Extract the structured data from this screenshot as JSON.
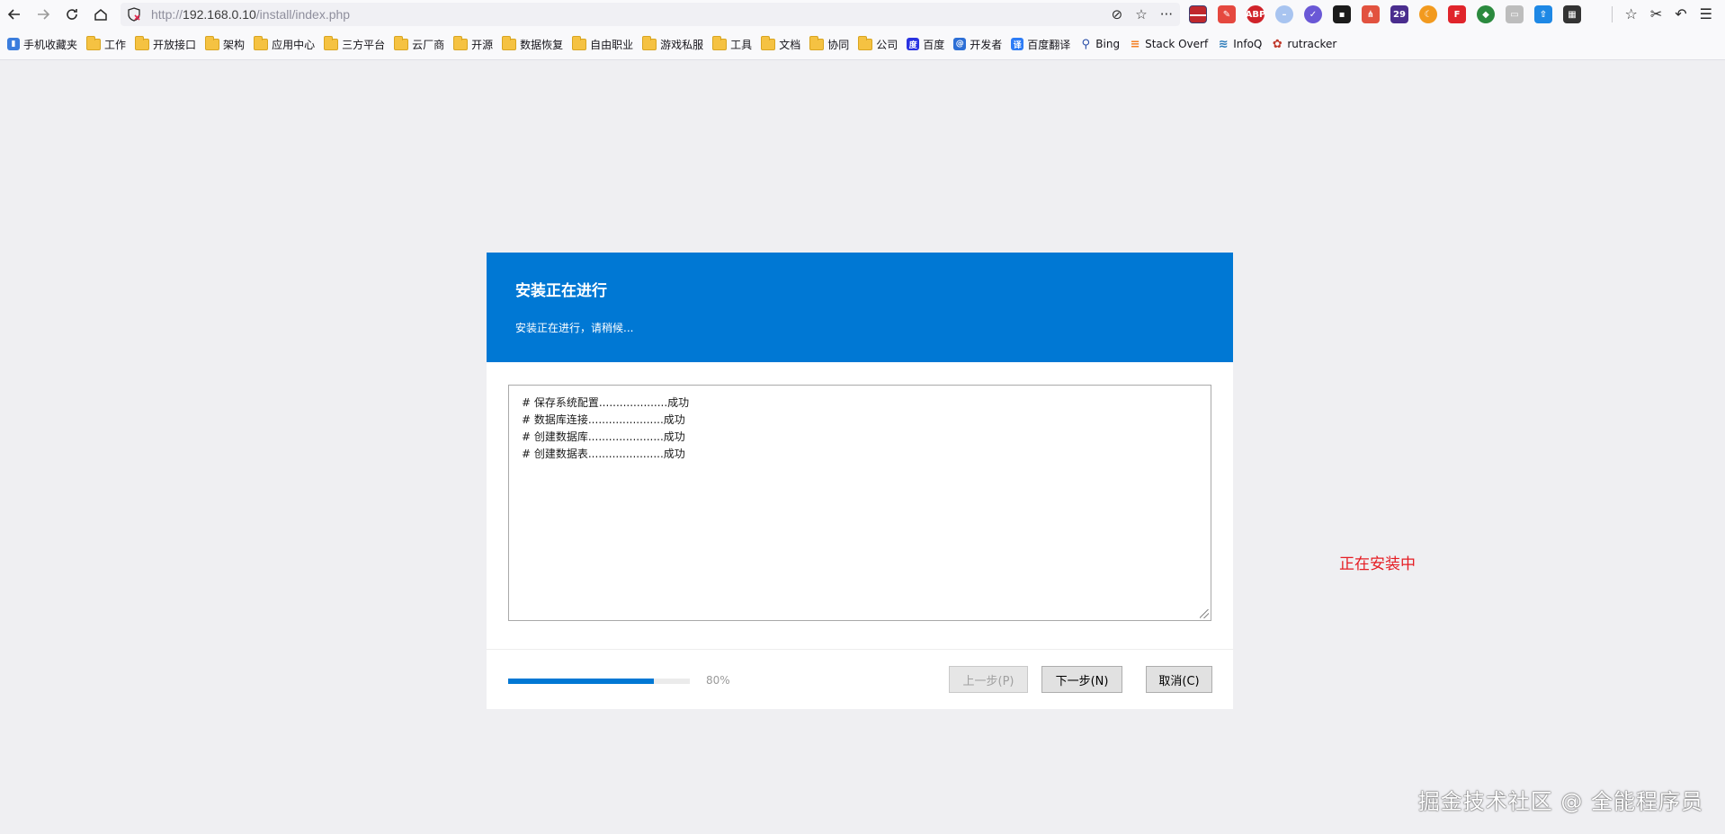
{
  "browser": {
    "url_prefix": "http://",
    "url_host": "192.168.0.10",
    "url_path": "/install/index.php"
  },
  "bookmarks": [
    {
      "label": "手机收藏夹",
      "icon": "mobile-bookmarks-icon"
    },
    {
      "label": "工作",
      "icon": "folder-icon"
    },
    {
      "label": "开放接口",
      "icon": "folder-icon"
    },
    {
      "label": "架构",
      "icon": "folder-icon"
    },
    {
      "label": "应用中心",
      "icon": "folder-icon"
    },
    {
      "label": "三方平台",
      "icon": "folder-icon"
    },
    {
      "label": "云厂商",
      "icon": "folder-icon"
    },
    {
      "label": "开源",
      "icon": "folder-icon"
    },
    {
      "label": "数据恢复",
      "icon": "folder-icon"
    },
    {
      "label": "自由职业",
      "icon": "folder-icon"
    },
    {
      "label": "游戏私服",
      "icon": "folder-icon"
    },
    {
      "label": "工具",
      "icon": "folder-icon"
    },
    {
      "label": "文档",
      "icon": "folder-icon"
    },
    {
      "label": "协同",
      "icon": "folder-icon"
    },
    {
      "label": "公司",
      "icon": "folder-icon"
    },
    {
      "label": "百度",
      "icon": "baidu-icon"
    },
    {
      "label": "开发者",
      "icon": "developer-icon"
    },
    {
      "label": "百度翻译",
      "icon": "baidu-translate-icon"
    },
    {
      "label": "Bing",
      "icon": "search-icon"
    },
    {
      "label": "Stack Overf",
      "icon": "stackoverflow-icon"
    },
    {
      "label": "InfoQ",
      "icon": "infoq-icon"
    },
    {
      "label": "rutracker",
      "icon": "rutracker-icon"
    }
  ],
  "dialog": {
    "title": "安装正在进行",
    "subtitle": "安装正在进行，请稍候...",
    "log": [
      "# 保存系统配置....................成功",
      "# 数据库连接......................成功",
      "# 创建数据库......................成功",
      "# 创建数据表......................成功"
    ],
    "progress_value": 80,
    "progress_label": "80%",
    "buttons": {
      "prev": "上一步(P)",
      "next": "下一步(N)",
      "cancel": "取消(C)"
    }
  },
  "status_note": "正在安装中",
  "watermark": "掘金技术社区 @ 全能程序员",
  "colors": {
    "accent": "#0078d4",
    "status_red": "#e51c23",
    "page_bg": "#efeff2"
  }
}
